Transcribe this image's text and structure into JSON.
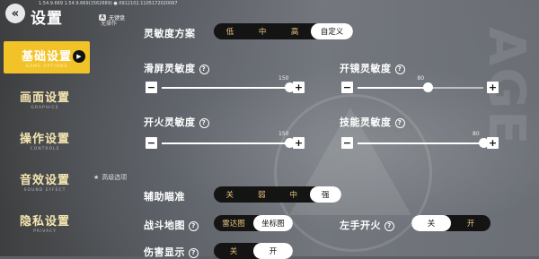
{
  "header": {
    "title": "设置",
    "build": "1.54.9.669  1.54.9.669(1562689)  ●  0912102.1105172020067",
    "hotkey": {
      "key": "A",
      "label": "无键盘"
    },
    "vip_label": "无操作"
  },
  "sidebar": {
    "items": [
      {
        "label": "基础设置",
        "sub": "GAME OPTIONS",
        "active": true
      },
      {
        "label": "画面设置",
        "sub": "GRAPHICS",
        "active": false
      },
      {
        "label": "操作设置",
        "sub": "CONTROLS",
        "active": false
      },
      {
        "label": "音效设置",
        "sub": "SOUND EFFECT",
        "active": false
      },
      {
        "label": "隐私设置",
        "sub": "PRIVACY",
        "active": false
      }
    ],
    "advanced_label": "高级选项"
  },
  "sensitivity_preset": {
    "label": "灵敏度方案",
    "options": [
      "低",
      "中",
      "高",
      "自定义"
    ],
    "selected": 3
  },
  "sliders": [
    {
      "key": "screen",
      "label": "滑屏灵敏度",
      "value_label": "150",
      "level": 1.0
    },
    {
      "key": "scope",
      "label": "开镜灵敏度",
      "value_label": "80",
      "level": 0.56
    },
    {
      "key": "fire",
      "label": "开火灵敏度",
      "value_label": "150",
      "level": 1.0
    },
    {
      "key": "skill",
      "label": "技能灵敏度",
      "value_label": "80",
      "level": 1.0
    }
  ],
  "aim_assist": {
    "label": "辅助瞄准",
    "options": [
      "关",
      "弱",
      "中",
      "强"
    ],
    "selected": 3
  },
  "battle_map": {
    "label": "战斗地图",
    "options": [
      "雷达图",
      "坐标图"
    ],
    "selected": 1
  },
  "left_fire": {
    "label": "左手开火",
    "options": [
      "关",
      "开"
    ],
    "selected": 0
  },
  "damage_display": {
    "label": "伤害显示",
    "options": [
      "关",
      "开"
    ],
    "selected": 1
  },
  "icons": {
    "back": "double-chevron-left-icon",
    "play": "play-icon",
    "help": "question-circle-icon",
    "minus": "minus-icon",
    "plus": "plus-icon",
    "star": "star-icon"
  },
  "colors": {
    "accent": "#f2c229",
    "sidebar_text": "#f5e6b0",
    "segment_bg": "#141414",
    "segment_text": "#e8c57a"
  },
  "background_letters": "AGE"
}
